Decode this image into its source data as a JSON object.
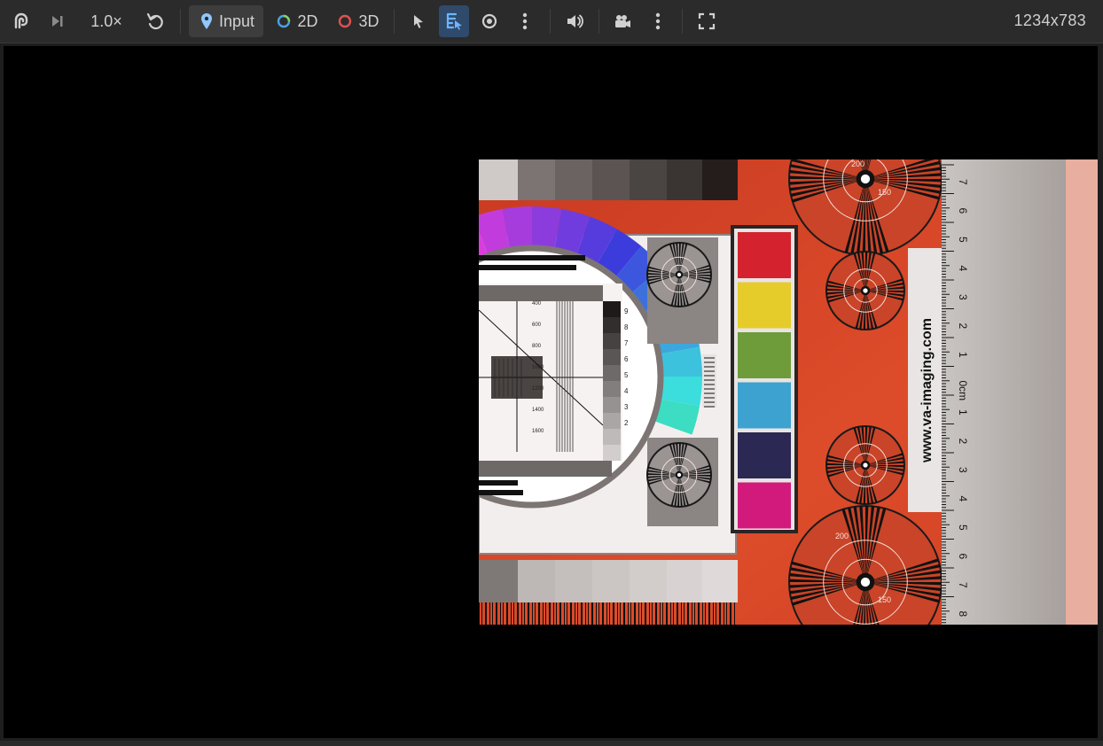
{
  "toolbar": {
    "speed_label": "1.0×",
    "input_label": "Input",
    "mode_2d_label": "2D",
    "mode_3d_label": "3D",
    "resolution": "1234x783"
  },
  "colors": {
    "toolbar_bg": "#2b2b2b",
    "viewport_bg": "#000000",
    "active_button_bg": "#3d3d3d",
    "selected_tool_bg": "#2f4a6a",
    "mode_2d_ring": "#4aa3e0",
    "mode_3d_ring": "#e05050"
  },
  "icons": {
    "logo": "fingerprint-logo-icon",
    "step": "step-forward-icon",
    "reset": "undo-icon",
    "input": "pin-icon",
    "select": "cursor-arrow-icon",
    "select_box": "select-list-icon",
    "visibility": "eye-icon",
    "more": "more-vertical-icon",
    "audio": "volume-icon",
    "camera": "video-camera-icon",
    "fullscreen": "fullscreen-icon"
  },
  "test_chart": {
    "website": "www.va-imaging.com",
    "ruler_labels": [
      "7",
      "6",
      "5",
      "4",
      "3",
      "2",
      "1",
      "0cm",
      "1",
      "2",
      "3",
      "4",
      "5",
      "6",
      "7",
      "8"
    ],
    "resolution_values": [
      "400",
      "600",
      "800",
      "1000",
      "1200",
      "1400",
      "1600"
    ],
    "grey_step_numbers": [
      "9",
      "8",
      "7",
      "6",
      "5",
      "4",
      "3",
      "2"
    ],
    "siemens_labels": [
      "200",
      "150"
    ],
    "color_patches": [
      "#d4222e",
      "#e6cc2a",
      "#6e9c3a",
      "#3da2cf",
      "#2b2854",
      "#d11a7c"
    ]
  }
}
